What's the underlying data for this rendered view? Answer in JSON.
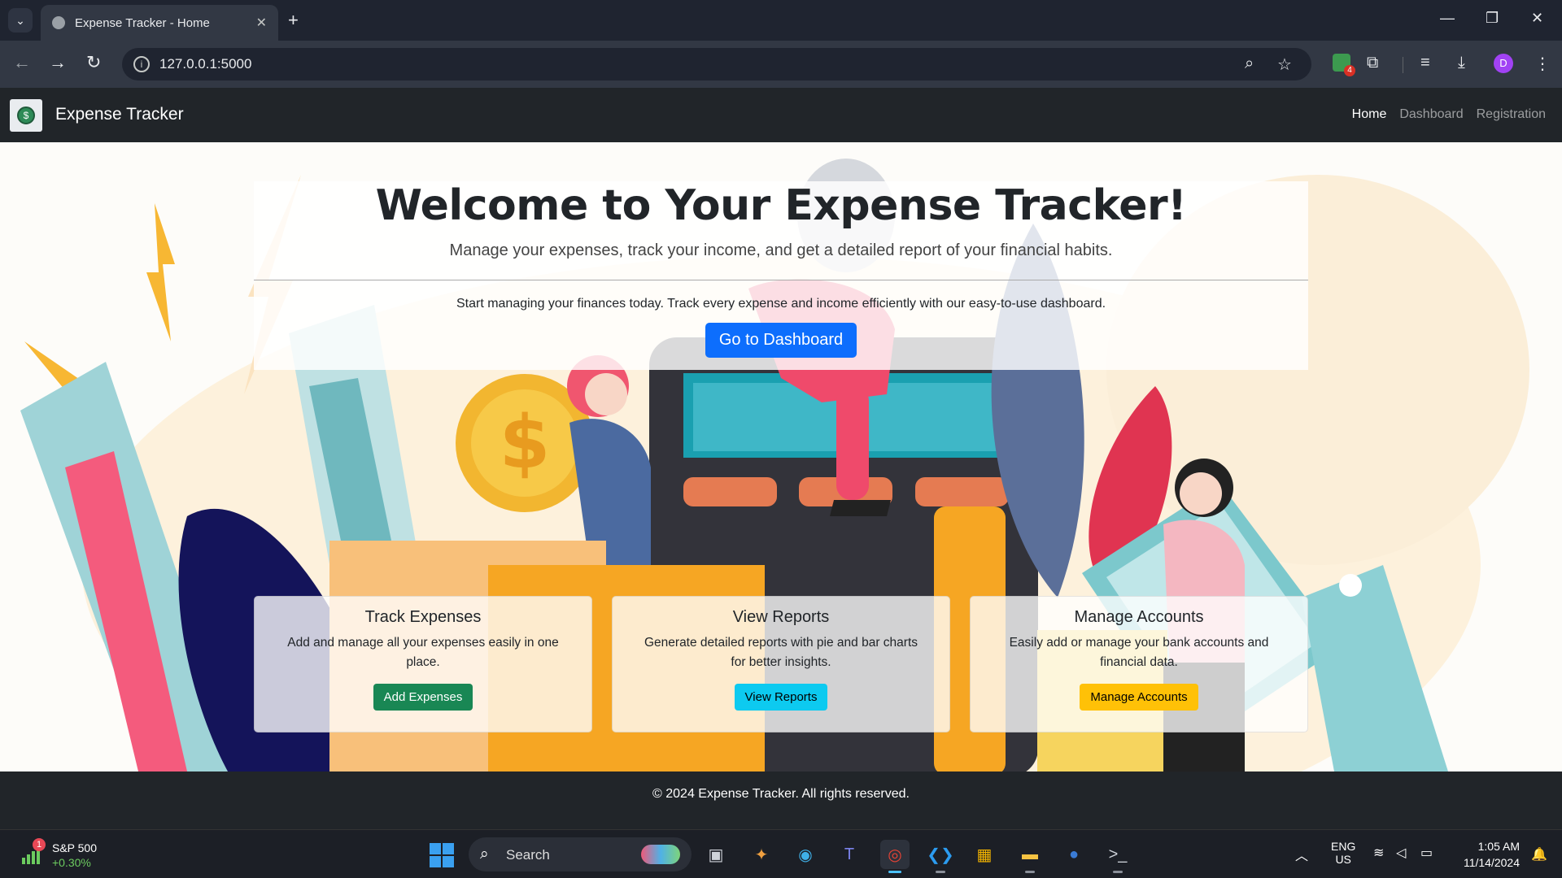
{
  "browser": {
    "tab_title": "Expense Tracker - Home",
    "url": "127.0.0.1:5000",
    "extension_badge_count": "4",
    "profile_initial": "D"
  },
  "site": {
    "brand": "Expense Tracker",
    "nav": [
      {
        "label": "Home",
        "active": true
      },
      {
        "label": "Dashboard",
        "active": false
      },
      {
        "label": "Registration",
        "active": false
      }
    ]
  },
  "hero": {
    "title": "Welcome to Your Expense Tracker!",
    "lead": "Manage your expenses, track your income, and get a detailed report of your financial habits.",
    "intro": "Start managing your finances today. Track every expense and income efficiently with our easy-to-use dashboard.",
    "cta_label": "Go to Dashboard",
    "cta_color": "#0d6efd"
  },
  "cards": [
    {
      "title": "Track Expenses",
      "text": "Add and manage all your expenses easily in one place.",
      "button": "Add Expenses",
      "button_color": "#198754"
    },
    {
      "title": "View Reports",
      "text": "Generate detailed reports with pie and bar charts for better insights.",
      "button": "View Reports",
      "button_color": "#0dcaf0"
    },
    {
      "title": "Manage Accounts",
      "text": "Easily add or manage your bank accounts and financial data.",
      "button": "Manage Accounts",
      "button_color": "#ffc107"
    }
  ],
  "footer": {
    "text": "© 2024 Expense Tracker. All rights reserved."
  },
  "taskbar": {
    "stock_name": "S&P 500",
    "stock_change": "+0.30%",
    "stock_badge": "1",
    "search_label": "Search",
    "lang_top": "ENG",
    "lang_bottom": "US",
    "time": "1:05 AM",
    "date": "11/14/2024",
    "apps": [
      "task-view",
      "copilot",
      "edge",
      "teams",
      "chrome",
      "vscode",
      "store",
      "file-explorer",
      "dell",
      "terminal"
    ]
  }
}
